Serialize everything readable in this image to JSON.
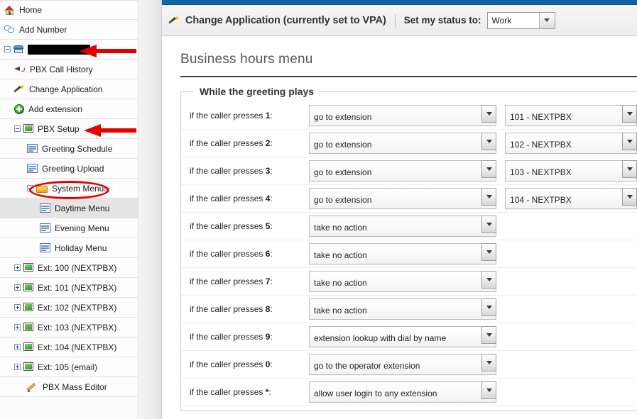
{
  "sidebar": {
    "items": [
      {
        "label": "Home",
        "icon": "home-icon",
        "indent": 0,
        "expander": "",
        "selected": false,
        "redacted": false,
        "annotation": ""
      },
      {
        "label": "Add Number",
        "icon": "speech-bubble-icon",
        "indent": 0,
        "expander": "",
        "selected": false,
        "redacted": false,
        "annotation": ""
      },
      {
        "label": "",
        "icon": "phone-icon",
        "indent": 0,
        "expander": "minus",
        "selected": false,
        "redacted": true,
        "annotation": "arrow"
      },
      {
        "label": "PBX Call History",
        "icon": "speaker-icon",
        "indent": 1,
        "expander": "",
        "selected": false,
        "redacted": false,
        "annotation": ""
      },
      {
        "label": "Change Application",
        "icon": "magic-wand-icon",
        "indent": 1,
        "expander": "",
        "selected": false,
        "redacted": false,
        "annotation": ""
      },
      {
        "label": "Add extension",
        "icon": "add-circle-icon",
        "indent": 1,
        "expander": "",
        "selected": false,
        "redacted": false,
        "annotation": ""
      },
      {
        "label": "PBX Setup",
        "icon": "monitor-icon",
        "indent": 1,
        "expander": "minus",
        "selected": false,
        "redacted": false,
        "annotation": "arrow"
      },
      {
        "label": "Greeting Schedule",
        "icon": "document-icon",
        "indent": 2,
        "expander": "",
        "selected": false,
        "redacted": false,
        "annotation": ""
      },
      {
        "label": "Greeting Upload",
        "icon": "document-icon",
        "indent": 2,
        "expander": "",
        "selected": false,
        "redacted": false,
        "annotation": ""
      },
      {
        "label": "System Menus",
        "icon": "folder-icon",
        "indent": 2,
        "expander": "minus",
        "selected": false,
        "redacted": false,
        "annotation": "ellipse"
      },
      {
        "label": "Daytime Menu",
        "icon": "document-icon",
        "indent": 3,
        "expander": "",
        "selected": true,
        "redacted": false,
        "annotation": ""
      },
      {
        "label": "Evening Menu",
        "icon": "document-icon",
        "indent": 3,
        "expander": "",
        "selected": false,
        "redacted": false,
        "annotation": ""
      },
      {
        "label": "Holiday Menu",
        "icon": "document-icon",
        "indent": 3,
        "expander": "",
        "selected": false,
        "redacted": false,
        "annotation": ""
      },
      {
        "label": "Ext: 100 (NEXTPBX)",
        "icon": "monitor-icon",
        "indent": 1,
        "expander": "plus",
        "selected": false,
        "redacted": false,
        "annotation": ""
      },
      {
        "label": "Ext: 101 (NEXTPBX)",
        "icon": "monitor-icon",
        "indent": 1,
        "expander": "plus",
        "selected": false,
        "redacted": false,
        "annotation": ""
      },
      {
        "label": "Ext: 102 (NEXTPBX)",
        "icon": "monitor-icon",
        "indent": 1,
        "expander": "plus",
        "selected": false,
        "redacted": false,
        "annotation": ""
      },
      {
        "label": "Ext: 103 (NEXTPBX)",
        "icon": "monitor-icon",
        "indent": 1,
        "expander": "plus",
        "selected": false,
        "redacted": false,
        "annotation": ""
      },
      {
        "label": "Ext: 104 (NEXTPBX)",
        "icon": "monitor-icon",
        "indent": 1,
        "expander": "plus",
        "selected": false,
        "redacted": false,
        "annotation": ""
      },
      {
        "label": "Ext: 105 (email)",
        "icon": "monitor-icon",
        "indent": 1,
        "expander": "plus",
        "selected": false,
        "redacted": false,
        "annotation": ""
      },
      {
        "label": "PBX Mass Editor",
        "icon": "pencil-icon",
        "indent": 2,
        "expander": "",
        "selected": false,
        "redacted": false,
        "annotation": ""
      }
    ]
  },
  "appbar": {
    "change_application_label": "Change Application (currently set to VPA)",
    "status_label": "Set my status to:",
    "status_value": "Work"
  },
  "page": {
    "title": "Business hours menu",
    "fieldset_legend": "While the greeting plays",
    "rows": [
      {
        "label_prefix": "if the caller presses ",
        "key": "1",
        "label_suffix": ":",
        "action": "go to extension",
        "target": "101 - NEXTPBX",
        "has_target": true
      },
      {
        "label_prefix": "if the caller presses ",
        "key": "2",
        "label_suffix": ":",
        "action": "go to extension",
        "target": "102 - NEXTPBX",
        "has_target": true
      },
      {
        "label_prefix": "if the caller presses ",
        "key": "3",
        "label_suffix": ":",
        "action": "go to extension",
        "target": "103 - NEXTPBX",
        "has_target": true
      },
      {
        "label_prefix": "if the caller presses ",
        "key": "4",
        "label_suffix": ":",
        "action": "go to extension",
        "target": "104 - NEXTPBX",
        "has_target": true
      },
      {
        "label_prefix": "if the caller presses ",
        "key": "5",
        "label_suffix": ":",
        "action": "take no action",
        "target": "",
        "has_target": false
      },
      {
        "label_prefix": "if the caller presses ",
        "key": "6",
        "label_suffix": ":",
        "action": "take no action",
        "target": "",
        "has_target": false
      },
      {
        "label_prefix": "if the caller presses ",
        "key": "7",
        "label_suffix": ":",
        "action": "take no action",
        "target": "",
        "has_target": false
      },
      {
        "label_prefix": "if the caller presses ",
        "key": "8",
        "label_suffix": ":",
        "action": "take no action",
        "target": "",
        "has_target": false
      },
      {
        "label_prefix": "if the caller presses ",
        "key": "9",
        "label_suffix": ":",
        "action": "extension lookup with dial by name",
        "target": "",
        "has_target": false
      },
      {
        "label_prefix": "if the caller presses ",
        "key": "0",
        "label_suffix": ":",
        "action": "go to the operator extension",
        "target": "",
        "has_target": false
      },
      {
        "label_prefix": "if the caller presses ",
        "key": "*",
        "label_suffix": ":",
        "action": "allow user login to any extension",
        "target": "",
        "has_target": false
      }
    ]
  },
  "colors": {
    "top_bar_blue": "#1465a8",
    "annotation_red": "#e50000",
    "selected_row_gray": "#e4e4e4",
    "title_gray": "#555555"
  }
}
